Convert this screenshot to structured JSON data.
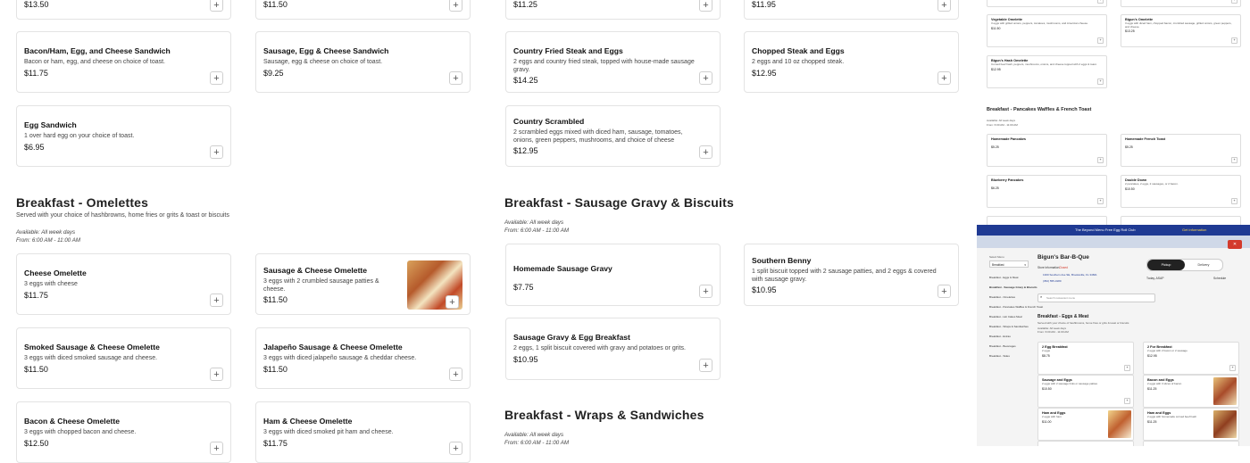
{
  "top_prices": [
    "$13.50",
    "$11.50",
    "$11.25",
    "$11.95"
  ],
  "eggs_cards": [
    {
      "title": "Bacon/Ham, Egg, and Cheese Sandwich",
      "desc": "Bacon or ham, egg, and cheese on choice of toast.",
      "price": "$11.75"
    },
    {
      "title": "Sausage, Egg & Cheese Sandwich",
      "desc": "Sausage, egg & cheese on choice of toast.",
      "price": "$9.25"
    },
    {
      "title": "Country Fried Steak and Eggs",
      "desc": "2 eggs and country fried steak, topped with house-made sausage gravy.",
      "price": "$14.25"
    },
    {
      "title": "Chopped Steak and Eggs",
      "desc": "2 eggs and 10 oz chopped steak.",
      "price": "$12.95"
    },
    {
      "title": "Egg Sandwich",
      "desc": "1 over hard egg on your choice of toast.",
      "price": "$6.95"
    },
    {
      "title": "Country Scrambled",
      "desc": "2 scrambled eggs mixed with diced ham, sausage, tomatoes, onions, green peppers, mushrooms, and choice of cheese",
      "price": "$12.95"
    }
  ],
  "omelettes": {
    "title": "Breakfast - Omelettes",
    "subtitle": "Served with your choice of hashbrowns, home fries or grits & toast or biscuits",
    "available": "Available: All week days",
    "hours": "From: 6:00 AM - 11:00 AM",
    "items": [
      {
        "title": "Cheese Omelette",
        "desc": "3 eggs with cheese",
        "price": "$11.75"
      },
      {
        "title": "Sausage & Cheese Omelette",
        "desc": "3 eggs with 2 crumbled sausage patties & cheese.",
        "price": "$11.50"
      },
      {
        "title": "Smoked Sausage & Cheese Omelette",
        "desc": "3 eggs with diced smoked sausage and cheese.",
        "price": "$11.50"
      },
      {
        "title": "Jalapeño Sausage & Cheese Omelette",
        "desc": "3 eggs with diced jalapeño sausage & cheddar cheese.",
        "price": "$11.50"
      },
      {
        "title": "Bacon & Cheese Omelette",
        "desc": "3 eggs with chopped bacon and cheese.",
        "price": "$12.50"
      },
      {
        "title": "Ham & Cheese Omelette",
        "desc": "3 eggs with diced smoked pit ham and cheese.",
        "price": "$11.75"
      }
    ]
  },
  "gravy": {
    "title": "Breakfast - Sausage Gravy & Biscuits",
    "available": "Available: All week days",
    "hours": "From: 6:00 AM - 11:00 AM",
    "items": [
      {
        "title": "Homemade Sausage Gravy",
        "desc": "",
        "price": "$7.75"
      },
      {
        "title": "Southern Benny",
        "desc": "1 split biscuit topped with 2 sausage patties, and 2 eggs & covered with sausage gravy.",
        "price": "$10.95"
      },
      {
        "title": "Sausage Gravy & Egg Breakfast",
        "desc": "2 eggs, 1 split biscuit covered with gravy and potatoes or grits.",
        "price": "$10.95"
      }
    ]
  },
  "wraps": {
    "title": "Breakfast - Wraps & Sandwiches",
    "available": "Available: All week days",
    "hours": "From: 6:00 AM - 11:00 AM"
  },
  "mini_top": {
    "cards": [
      {
        "title": "Vegetable Omelette",
        "desc": "3 eggs with grilled onions, peppers, tomatoes, mushrooms, and American cheese.",
        "price": "$11.50"
      },
      {
        "title": "Bigun's Omelette",
        "desc": "3 eggs with diced ham, chopped bacon, crumbled sausage, grilled onions, green peppers, and cheese.",
        "price": "$13.25"
      },
      {
        "title": "Bigun's Hash Omelette",
        "desc": "Corned beef hash, peppers, mushrooms, onions, and cheese topped with 2 eggs & toast.",
        "price": "$12.95"
      }
    ],
    "section_title": "Breakfast - Pancakes Waffles & French Toast",
    "section_avail": "Available: All week days",
    "section_hours": "From: 6:00 AM - 11:00 AM",
    "cards2": [
      {
        "title": "Homemade Pancakes",
        "desc": "",
        "price": "$5.25"
      },
      {
        "title": "Homemade French Toast",
        "desc": "",
        "price": "$5.25"
      },
      {
        "title": "Blueberry Pancakes",
        "desc": "",
        "price": "$6.25"
      },
      {
        "title": "Double Down",
        "desc": "2 pancakes, 2 eggs, 2 sausages, or 2 bacon.",
        "price": "$10.50"
      }
    ]
  },
  "mini_bottom": {
    "banner": "The Beyond Menu Free Egg Roll Club",
    "banner_link": "Get information",
    "restaurant": "Bigun's Bar-B-Que",
    "store_info": "Store Information",
    "status": "Closed",
    "address": "1300 Southern Ave SE, Brooksville, FL 34601",
    "phone": "(352) 555-0180",
    "search_placeholder": "Search restaurant menu",
    "pickup": "Pickup",
    "delivery": "Delivery",
    "pickup_time": "Today, ASAP",
    "schedule": "Schedule",
    "menu_label": "Select Menu",
    "menu_value": "Breakfast",
    "nav": [
      "Breakfast - Eggs & Meat",
      "Breakfast - Sausage Gravy & Biscuits",
      "Breakfast - Omelettes",
      "Breakfast - Pancakes Waffles & French Toast",
      "Breakfast - Hot Cakes Meal",
      "Breakfast - Wraps & Sandwiches",
      "Breakfast - Extras",
      "Breakfast - Beverages",
      "Breakfast - Sides"
    ],
    "section_title": "Breakfast - Eggs & Meat",
    "section_sub": "Served with your choice of hashbrowns, home fries or grits & toast or biscuits",
    "section_avail": "Available: All week days",
    "section_hours": "From: 6:00 AM - 11:00 AM",
    "cards": [
      {
        "title": "2 Egg Breakfast",
        "desc": "2 eggs",
        "price": "$8.75"
      },
      {
        "title": "2 For Breakfast",
        "desc": "2 eggs with 2 bacon or 2 sausage",
        "price": "$12.95"
      },
      {
        "title": "Sausage and Eggs",
        "desc": "2 eggs with 2 sausage links or sausage patties",
        "price": "$10.50"
      },
      {
        "title": "Bacon and Eggs",
        "desc": "2 eggs with 3 slices of bacon",
        "price": "$11.25"
      },
      {
        "title": "Ham and Eggs",
        "desc": "2 eggs with ham",
        "price": "$11.00"
      },
      {
        "title": "Ham and Eggs",
        "desc": "2 eggs with homemade corned beef hash",
        "price": "$11.25"
      }
    ]
  },
  "colors": {
    "accent": "#d33a2c",
    "banner": "#1f3a93",
    "mini_bg": "#cfd8e8"
  }
}
